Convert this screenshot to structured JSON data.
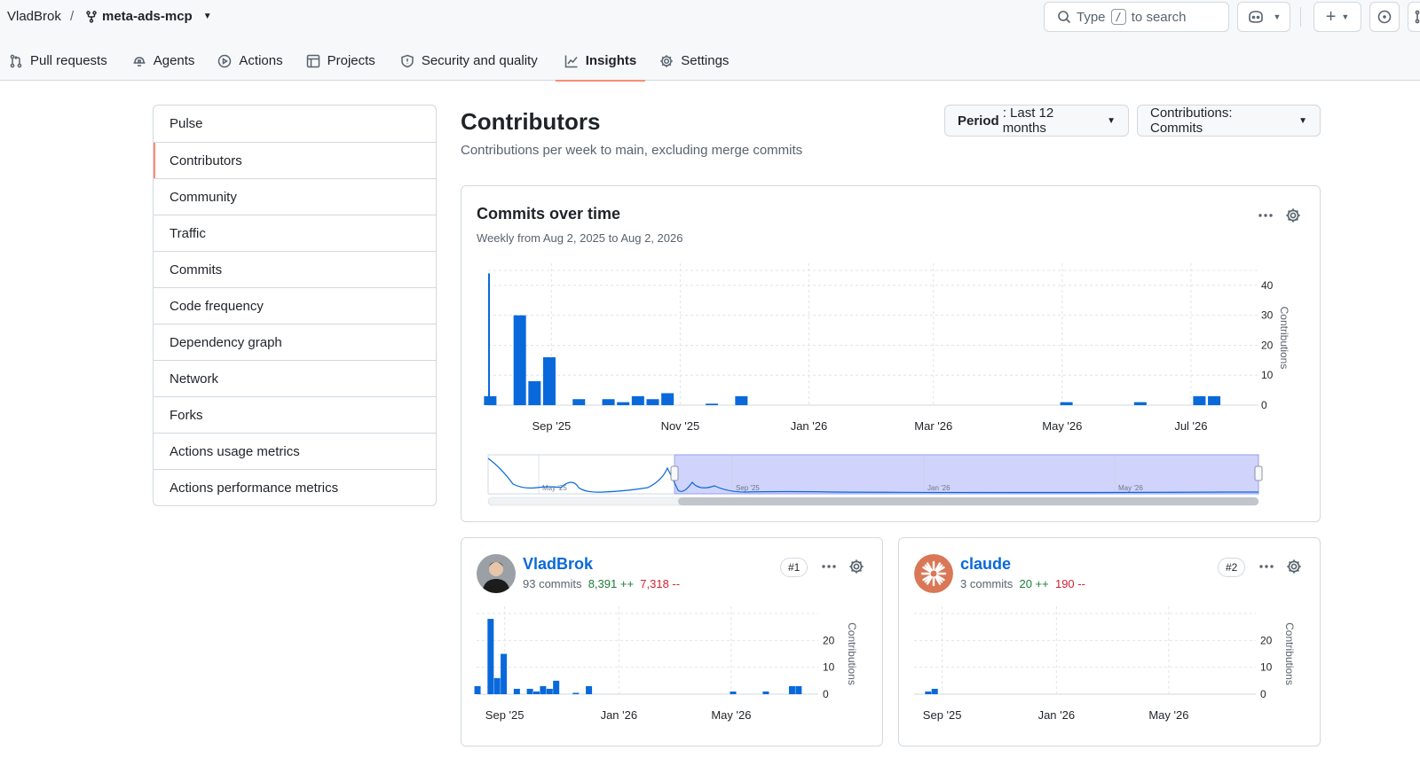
{
  "header": {
    "owner": "VladBrok",
    "separator": "/",
    "repo": "meta-ads-mcp",
    "search": {
      "prefix": "Type",
      "key": "/",
      "suffix": "to search"
    }
  },
  "tabs": [
    {
      "label": "Pull requests",
      "icon": "pull-request-icon"
    },
    {
      "label": "Agents",
      "icon": "agent-icon"
    },
    {
      "label": "Actions",
      "icon": "play-icon"
    },
    {
      "label": "Projects",
      "icon": "table-icon"
    },
    {
      "label": "Security and quality",
      "icon": "shield-icon"
    },
    {
      "label": "Insights",
      "icon": "graph-icon",
      "active": true
    },
    {
      "label": "Settings",
      "icon": "gear-icon"
    }
  ],
  "sidebar": {
    "items": [
      {
        "label": "Pulse"
      },
      {
        "label": "Contributors",
        "active": true
      },
      {
        "label": "Community"
      },
      {
        "label": "Traffic"
      },
      {
        "label": "Commits"
      },
      {
        "label": "Code frequency"
      },
      {
        "label": "Dependency graph"
      },
      {
        "label": "Network"
      },
      {
        "label": "Forks"
      },
      {
        "label": "Actions usage metrics"
      },
      {
        "label": "Actions performance metrics"
      }
    ]
  },
  "main": {
    "title": "Contributors",
    "subtitle": "Contributions per week to main, excluding merge commits",
    "period": {
      "label": "Period",
      "value": ": Last 12 months"
    },
    "contributions": {
      "label": "Contributions: Commits"
    }
  },
  "commits_card": {
    "title": "Commits over time",
    "subtitle": "Weekly from Aug 2, 2025 to Aug 2, 2026"
  },
  "contributors": [
    {
      "name": "VladBrok",
      "commits": "93 commits",
      "additions": "8,391 ++",
      "deletions": "7,318 --",
      "rank": "#1"
    },
    {
      "name": "claude",
      "commits": "3 commits",
      "additions": "20 ++",
      "deletions": "190 --",
      "rank": "#2"
    }
  ],
  "colors": {
    "bar": "#0969da",
    "accent": "#fd8c73",
    "link": "#0969da",
    "add": "#1a7f37",
    "del": "#d1242f",
    "range": "#c8cdfb",
    "claude": "#d97757"
  },
  "chart_data": [
    {
      "type": "bar",
      "name": "commits-over-time",
      "xlabel": "",
      "ylabel": "Contributions",
      "ylim": [
        0,
        45
      ],
      "yticks": [
        0,
        10,
        20,
        30,
        40
      ],
      "xticks": [
        "Sep '25",
        "Nov '25",
        "Jan '26",
        "Mar '26",
        "May '26",
        "Jul '26"
      ],
      "weeks": [
        "2025-08-03",
        "2025-08-17",
        "2025-08-24",
        "2025-08-31",
        "2025-09-14",
        "2025-09-28",
        "2025-10-05",
        "2025-10-12",
        "2025-10-19",
        "2025-10-26",
        "2025-11-16",
        "2025-11-30",
        "2026-05-03",
        "2026-06-07",
        "2026-07-05",
        "2026-07-12"
      ],
      "values": [
        3,
        30,
        8,
        16,
        2,
        2,
        1,
        3,
        2,
        4,
        0.5,
        3,
        1,
        1,
        3,
        3
      ],
      "navigator": {
        "ticks": [
          "May '25",
          "Sep '25",
          "Jan '26",
          "May '26"
        ],
        "selection": "Aug 2, 2025 – Aug 2, 2026"
      }
    },
    {
      "type": "bar",
      "name": "VladBrok-contributions",
      "ylabel": "Contributions",
      "ylim": [
        0,
        30
      ],
      "yticks": [
        0,
        10,
        20
      ],
      "xticks": [
        "Sep '25",
        "Jan '26",
        "May '26"
      ],
      "weeks": [
        "2025-08-03",
        "2025-08-17",
        "2025-08-24",
        "2025-08-31",
        "2025-09-14",
        "2025-09-28",
        "2025-10-05",
        "2025-10-12",
        "2025-10-19",
        "2025-10-26",
        "2025-11-16",
        "2025-11-30",
        "2026-05-03",
        "2026-06-07",
        "2026-07-05",
        "2026-07-12"
      ],
      "values": [
        3,
        28,
        6,
        15,
        2,
        2,
        1,
        3,
        2,
        5,
        0.5,
        3,
        1,
        1,
        3,
        3
      ]
    },
    {
      "type": "bar",
      "name": "claude-contributions",
      "ylabel": "Contributions",
      "ylim": [
        0,
        30
      ],
      "yticks": [
        0,
        10,
        20
      ],
      "xticks": [
        "Sep '25",
        "Jan '26",
        "May '26"
      ],
      "weeks": [
        "2025-08-17",
        "2025-08-24"
      ],
      "values": [
        1,
        2
      ]
    }
  ]
}
